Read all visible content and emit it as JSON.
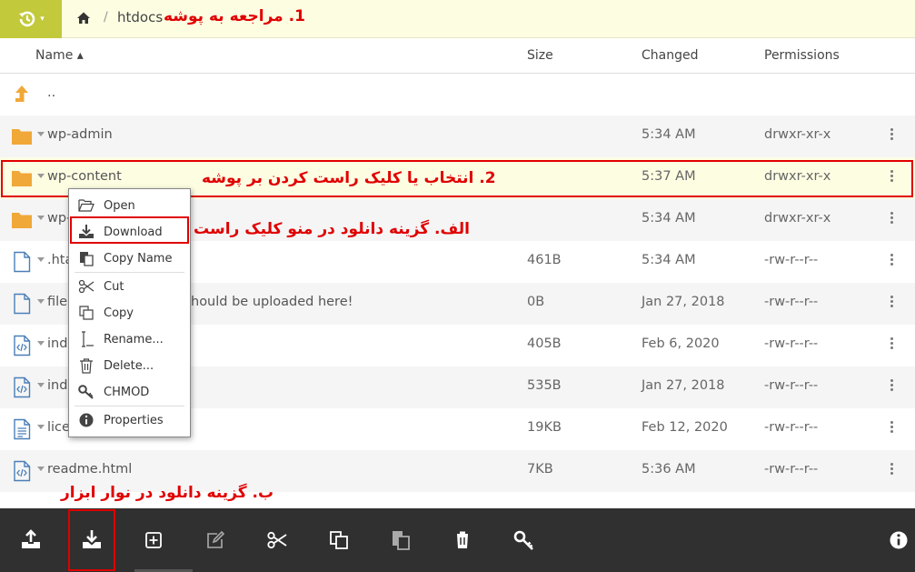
{
  "topbar": {
    "home_icon": "history-icon",
    "breadcrumb_home_icon": "home-icon",
    "breadcrumb_sep": "/",
    "current_folder": "htdocs",
    "accent": "#c2c93a"
  },
  "annotations": {
    "step1": "1. مراجعه به پوشه",
    "step2": "2. انتخاب یا کلیک راست کردن بر پوشه",
    "option_a": "الف. گزینه دانلود در منو کلیک راست",
    "option_b": "ب. گزینه دانلود در نوار ابزار",
    "color": "#e00000"
  },
  "table": {
    "headers": {
      "name": "Name ▴",
      "size": "Size",
      "changed": "Changed",
      "permissions": "Permissions"
    },
    "rows": [
      {
        "icon": "up-arrow-icon",
        "name": "..",
        "size": "",
        "changed": "",
        "permissions": ""
      },
      {
        "icon": "folder-icon",
        "name": "wp-admin",
        "size": "",
        "changed": "5:34 AM",
        "permissions": "drwxr-xr-x"
      },
      {
        "icon": "folder-icon",
        "name": "wp-content",
        "size": "",
        "changed": "5:37 AM",
        "permissions": "drwxr-xr-x"
      },
      {
        "icon": "folder-icon",
        "name": "wp-",
        "size": "",
        "changed": "5:34 AM",
        "permissions": "drwxr-xr-x"
      },
      {
        "icon": "file-icon",
        "name": ".hta",
        "size": "461B",
        "changed": "5:34 AM",
        "permissions": "-rw-r--r--"
      },
      {
        "icon": "file-icon",
        "name": "files",
        "name_tail": "hould be uploaded here!",
        "size": "0B",
        "changed": "Jan 27, 2018",
        "permissions": "-rw-r--r--"
      },
      {
        "icon": "code-file-icon",
        "name": "ind",
        "size": "405B",
        "changed": "Feb 6, 2020",
        "permissions": "-rw-r--r--"
      },
      {
        "icon": "code-file-icon",
        "name": "ind",
        "size": "535B",
        "changed": "Jan 27, 2018",
        "permissions": "-rw-r--r--"
      },
      {
        "icon": "text-file-icon",
        "name": "lice",
        "size": "19KB",
        "changed": "Feb 12, 2020",
        "permissions": "-rw-r--r--"
      },
      {
        "icon": "code-file-icon",
        "name": "readme.html",
        "size": "7KB",
        "changed": "5:36 AM",
        "permissions": "-rw-r--r--"
      }
    ]
  },
  "context_menu": {
    "items": [
      {
        "label": "Open",
        "icon": "folder-open-icon"
      },
      {
        "label": "Download",
        "icon": "download-icon"
      },
      {
        "label": "Copy Name",
        "icon": "clipboard-icon"
      },
      {
        "label": "Cut",
        "icon": "scissors-icon"
      },
      {
        "label": "Copy",
        "icon": "copy-icon"
      },
      {
        "label": "Rename...",
        "icon": "cursor-icon"
      },
      {
        "label": "Delete...",
        "icon": "trash-icon"
      },
      {
        "label": "CHMOD",
        "icon": "key-icon"
      },
      {
        "label": "Properties",
        "icon": "info-icon"
      }
    ]
  },
  "toolbar": {
    "buttons": [
      "upload-icon",
      "download-icon",
      "new-folder-icon",
      "edit-icon",
      "cut-icon",
      "copy-icon",
      "paste-icon",
      "delete-icon",
      "key-icon",
      "info-icon"
    ]
  }
}
